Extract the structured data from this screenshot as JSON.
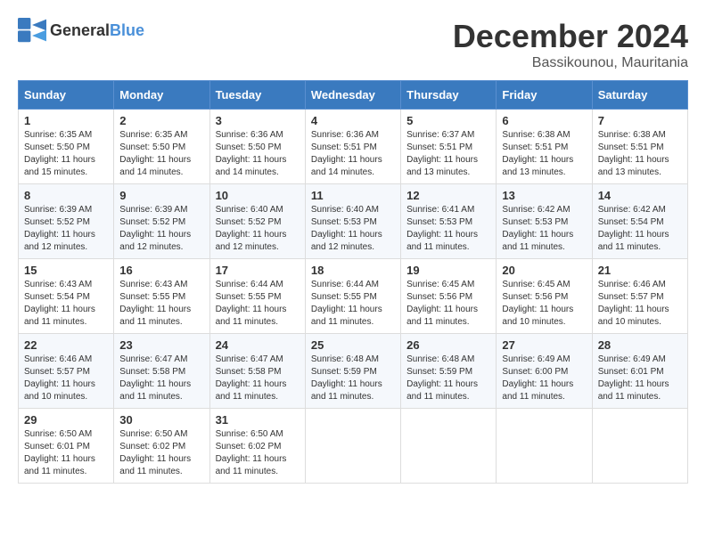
{
  "logo": {
    "general": "General",
    "blue": "Blue"
  },
  "header": {
    "month": "December 2024",
    "location": "Bassikounou, Mauritania"
  },
  "weekdays": [
    "Sunday",
    "Monday",
    "Tuesday",
    "Wednesday",
    "Thursday",
    "Friday",
    "Saturday"
  ],
  "weeks": [
    [
      {
        "day": "1",
        "sunrise": "6:35 AM",
        "sunset": "5:50 PM",
        "daylight": "11 hours and 15 minutes."
      },
      {
        "day": "2",
        "sunrise": "6:35 AM",
        "sunset": "5:50 PM",
        "daylight": "11 hours and 14 minutes."
      },
      {
        "day": "3",
        "sunrise": "6:36 AM",
        "sunset": "5:50 PM",
        "daylight": "11 hours and 14 minutes."
      },
      {
        "day": "4",
        "sunrise": "6:36 AM",
        "sunset": "5:51 PM",
        "daylight": "11 hours and 14 minutes."
      },
      {
        "day": "5",
        "sunrise": "6:37 AM",
        "sunset": "5:51 PM",
        "daylight": "11 hours and 13 minutes."
      },
      {
        "day": "6",
        "sunrise": "6:38 AM",
        "sunset": "5:51 PM",
        "daylight": "11 hours and 13 minutes."
      },
      {
        "day": "7",
        "sunrise": "6:38 AM",
        "sunset": "5:51 PM",
        "daylight": "11 hours and 13 minutes."
      }
    ],
    [
      {
        "day": "8",
        "sunrise": "6:39 AM",
        "sunset": "5:52 PM",
        "daylight": "11 hours and 12 minutes."
      },
      {
        "day": "9",
        "sunrise": "6:39 AM",
        "sunset": "5:52 PM",
        "daylight": "11 hours and 12 minutes."
      },
      {
        "day": "10",
        "sunrise": "6:40 AM",
        "sunset": "5:52 PM",
        "daylight": "11 hours and 12 minutes."
      },
      {
        "day": "11",
        "sunrise": "6:40 AM",
        "sunset": "5:53 PM",
        "daylight": "11 hours and 12 minutes."
      },
      {
        "day": "12",
        "sunrise": "6:41 AM",
        "sunset": "5:53 PM",
        "daylight": "11 hours and 11 minutes."
      },
      {
        "day": "13",
        "sunrise": "6:42 AM",
        "sunset": "5:53 PM",
        "daylight": "11 hours and 11 minutes."
      },
      {
        "day": "14",
        "sunrise": "6:42 AM",
        "sunset": "5:54 PM",
        "daylight": "11 hours and 11 minutes."
      }
    ],
    [
      {
        "day": "15",
        "sunrise": "6:43 AM",
        "sunset": "5:54 PM",
        "daylight": "11 hours and 11 minutes."
      },
      {
        "day": "16",
        "sunrise": "6:43 AM",
        "sunset": "5:55 PM",
        "daylight": "11 hours and 11 minutes."
      },
      {
        "day": "17",
        "sunrise": "6:44 AM",
        "sunset": "5:55 PM",
        "daylight": "11 hours and 11 minutes."
      },
      {
        "day": "18",
        "sunrise": "6:44 AM",
        "sunset": "5:55 PM",
        "daylight": "11 hours and 11 minutes."
      },
      {
        "day": "19",
        "sunrise": "6:45 AM",
        "sunset": "5:56 PM",
        "daylight": "11 hours and 11 minutes."
      },
      {
        "day": "20",
        "sunrise": "6:45 AM",
        "sunset": "5:56 PM",
        "daylight": "11 hours and 10 minutes."
      },
      {
        "day": "21",
        "sunrise": "6:46 AM",
        "sunset": "5:57 PM",
        "daylight": "11 hours and 10 minutes."
      }
    ],
    [
      {
        "day": "22",
        "sunrise": "6:46 AM",
        "sunset": "5:57 PM",
        "daylight": "11 hours and 10 minutes."
      },
      {
        "day": "23",
        "sunrise": "6:47 AM",
        "sunset": "5:58 PM",
        "daylight": "11 hours and 11 minutes."
      },
      {
        "day": "24",
        "sunrise": "6:47 AM",
        "sunset": "5:58 PM",
        "daylight": "11 hours and 11 minutes."
      },
      {
        "day": "25",
        "sunrise": "6:48 AM",
        "sunset": "5:59 PM",
        "daylight": "11 hours and 11 minutes."
      },
      {
        "day": "26",
        "sunrise": "6:48 AM",
        "sunset": "5:59 PM",
        "daylight": "11 hours and 11 minutes."
      },
      {
        "day": "27",
        "sunrise": "6:49 AM",
        "sunset": "6:00 PM",
        "daylight": "11 hours and 11 minutes."
      },
      {
        "day": "28",
        "sunrise": "6:49 AM",
        "sunset": "6:01 PM",
        "daylight": "11 hours and 11 minutes."
      }
    ],
    [
      {
        "day": "29",
        "sunrise": "6:50 AM",
        "sunset": "6:01 PM",
        "daylight": "11 hours and 11 minutes."
      },
      {
        "day": "30",
        "sunrise": "6:50 AM",
        "sunset": "6:02 PM",
        "daylight": "11 hours and 11 minutes."
      },
      {
        "day": "31",
        "sunrise": "6:50 AM",
        "sunset": "6:02 PM",
        "daylight": "11 hours and 11 minutes."
      },
      null,
      null,
      null,
      null
    ]
  ]
}
